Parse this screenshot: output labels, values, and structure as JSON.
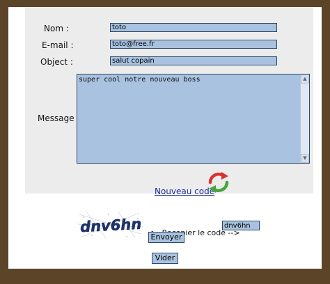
{
  "form": {
    "name_label": "Nom :",
    "name_value": "toto",
    "email_label": "E-mail :",
    "email_value": "toto@free.fr",
    "object_label": "Object :",
    "object_value": "salut copain",
    "message_label": "Message :",
    "message_value": "super cool notre nouveau boss"
  },
  "captcha": {
    "image_text": "dnv6hn",
    "new_code_link": "Nouveau code",
    "copy_label": "<-- Recopier le code -->",
    "input_value": "dnv6hn"
  },
  "buttons": {
    "send": "Envoyer",
    "clear": "Vider"
  },
  "colors": {
    "frame": "#5b4428",
    "panel": "#ececec",
    "field": "#a8c2df",
    "field_border": "#294868",
    "captcha_text": "#1e3370",
    "refresh_red": "#d8322f",
    "refresh_green": "#47a53a"
  },
  "icons": {
    "refresh": "refresh-arrows-icon",
    "scroll_up": "scroll-up-icon",
    "scroll_down": "scroll-down-icon"
  }
}
